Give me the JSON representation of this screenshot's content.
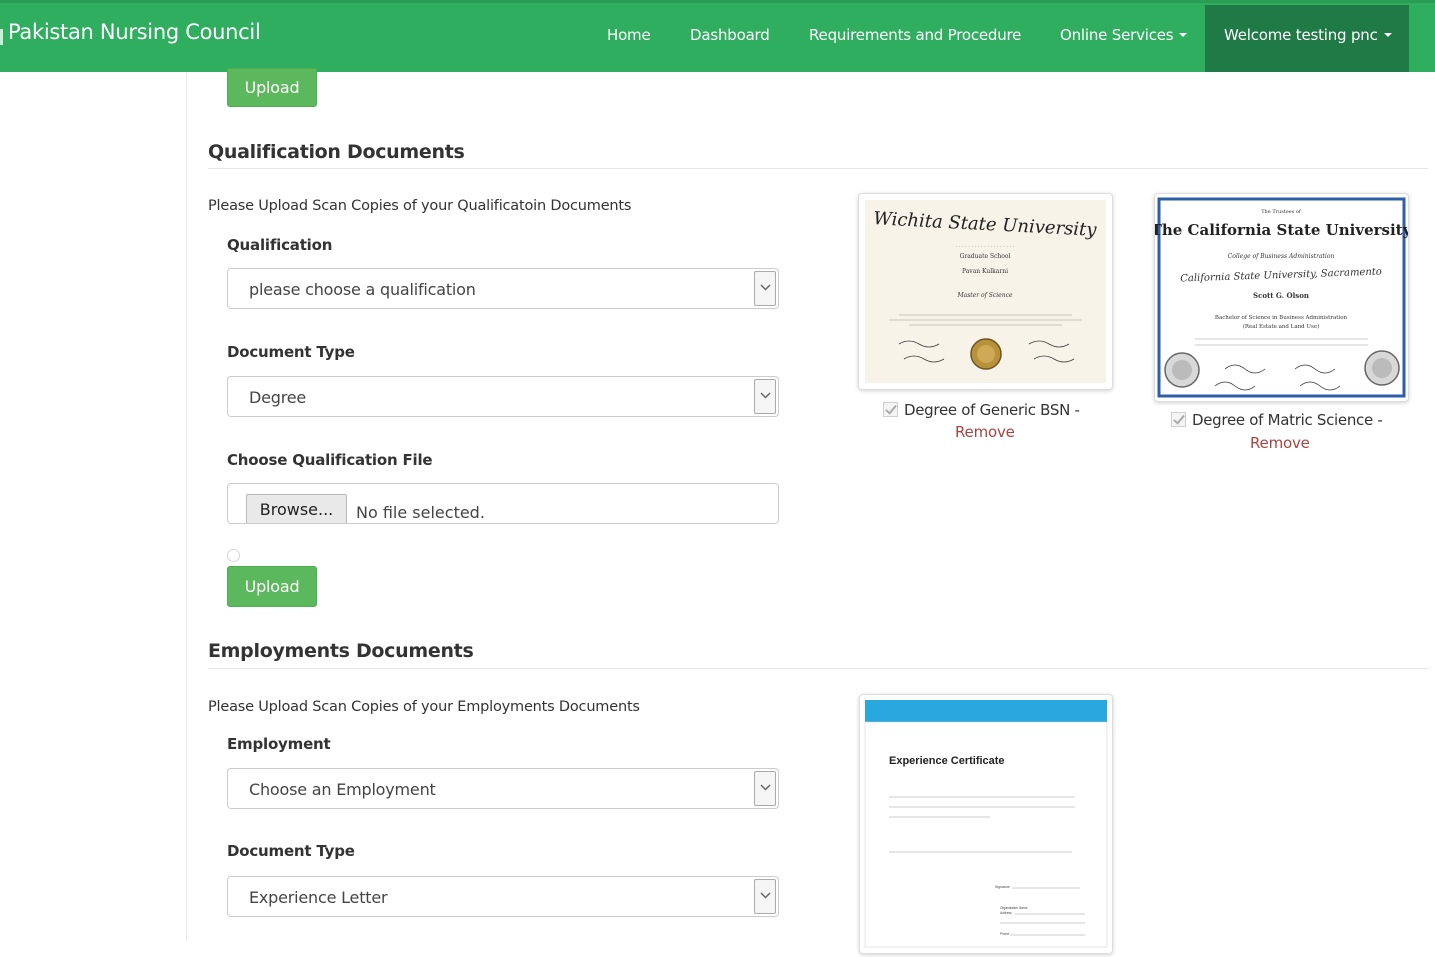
{
  "app": {
    "brand": "Pakistan Nursing Council"
  },
  "nav": {
    "home": "Home",
    "dashboard": "Dashboard",
    "requirements": "Requirements and Procedure",
    "online_services": "Online Services",
    "welcome": "Welcome testing pnc"
  },
  "colors": {
    "navbar": "#2eae5e",
    "welcome_bg": "#1f7a45",
    "button": "#5cb85c",
    "remove_link": "#a94442"
  },
  "top_upload": {
    "label": "Upload"
  },
  "qualification": {
    "title": "Qualification Documents",
    "hint": "Please Upload Scan Copies of your Qualificatoin Documents",
    "qualification_label": "Qualification",
    "qualification_value": "please choose a qualification",
    "doc_type_label": "Document Type",
    "doc_type_value": "Degree",
    "file_label": "Choose Qualification File",
    "browse_label": "Browse...",
    "file_status": "No file selected.",
    "upload_label": "Upload",
    "documents": [
      {
        "caption": "Degree of Generic BSN -",
        "remove": "Remove",
        "cert_university": "Wichita State University",
        "cert_school": "Graduate School",
        "cert_name": "Pavan Kulkarni",
        "cert_degree": "Master of Science"
      },
      {
        "caption": "Degree of Matric Science -",
        "remove": "Remove",
        "cert_header": "The Trustees of",
        "cert_university": "The California State University",
        "cert_college": "College of Business Administration",
        "cert_campus": "California State University, Sacramento",
        "cert_name": "Scott G. Olson",
        "cert_degree": "Bachelor of Science in Business Administration",
        "cert_major": "(Real Estate and Land Use)"
      }
    ]
  },
  "employment": {
    "title": "Employments Documents",
    "hint": "Please Upload Scan Copies of your Employments Documents",
    "employment_label": "Employment",
    "employment_value": "Choose an Employment",
    "doc_type_label": "Document Type",
    "doc_type_value": "Experience Letter",
    "documents": [
      {
        "cert_title": "Experience Certificate",
        "signature_label": "Signature",
        "org_label": "Organisation Name",
        "address_label": "Address",
        "phone_label": "Phone"
      }
    ]
  }
}
